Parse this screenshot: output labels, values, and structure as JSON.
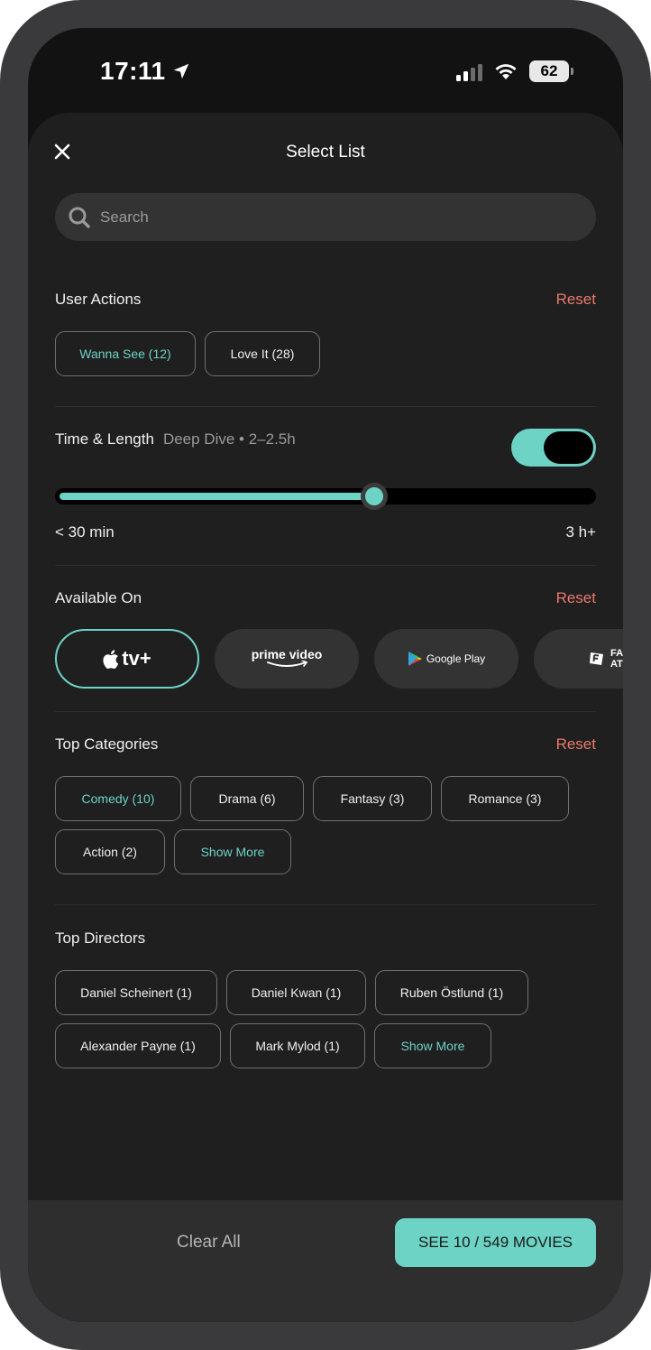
{
  "status_bar": {
    "time": "17:11",
    "battery": "62"
  },
  "header": {
    "title": "Select List"
  },
  "search": {
    "placeholder": "Search"
  },
  "user_actions": {
    "title": "User Actions",
    "reset": "Reset",
    "chips": [
      {
        "label": "Wanna See (12)",
        "active": true
      },
      {
        "label": "Love It (28)",
        "active": false
      }
    ]
  },
  "time_length": {
    "title": "Time & Length",
    "subtitle": "Deep Dive • 2–2.5h",
    "toggle_on": true,
    "slider_value_fraction": 0.59,
    "min_label": "< 30 min",
    "max_label": "3 h+"
  },
  "available_on": {
    "title": "Available On",
    "reset": "Reset",
    "platforms": [
      {
        "label": "tv+",
        "icon": "apple-icon",
        "active": true
      },
      {
        "label": "prime video",
        "icon": "amazon-smile-icon",
        "active": false
      },
      {
        "label": "Google Play",
        "icon": "google-play-icon",
        "active": false
      },
      {
        "label": "FANDANGO AT HOME",
        "icon": "fandango-icon",
        "active": false
      }
    ]
  },
  "top_categories": {
    "title": "Top Categories",
    "reset": "Reset",
    "row1": [
      "Comedy (10)",
      "Drama (6)",
      "Fantasy (3)",
      "Romance (3)"
    ],
    "row2": [
      "Action (2)"
    ],
    "show_more": "Show More"
  },
  "top_directors": {
    "title": "Top Directors",
    "row1": [
      "Daniel Scheinert (1)",
      "Daniel Kwan (1)",
      "Ruben Östlund (1)"
    ],
    "row2": [
      "Alexander Payne (1)",
      "Mark Mylod (1)"
    ],
    "show_more": "Show More"
  },
  "footer": {
    "clear_all": "Clear All",
    "see_movies": "SEE 10 / 549 MOVIES"
  },
  "colors": {
    "accent": "#6dd3c5",
    "reset": "#e9796a",
    "sheet_bg": "#1f1f1f"
  }
}
